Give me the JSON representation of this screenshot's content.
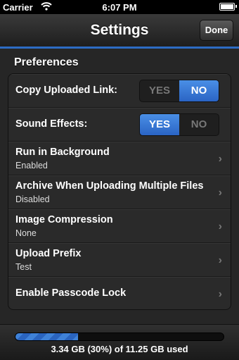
{
  "status_bar": {
    "carrier": "Carrier",
    "time": "6:07 PM"
  },
  "nav": {
    "title": "Settings",
    "done_label": "Done"
  },
  "preferences": {
    "header": "Preferences",
    "copy_link": {
      "label": "Copy Uploaded Link:",
      "yes": "YES",
      "no": "NO",
      "value": "NO"
    },
    "sound": {
      "label": "Sound Effects:",
      "yes": "YES",
      "no": "NO",
      "value": "YES"
    },
    "items": [
      {
        "label": "Run in Background",
        "value": "Enabled"
      },
      {
        "label": "Archive When Uploading Multiple Files",
        "value": "Disabled"
      },
      {
        "label": "Image Compression",
        "value": "None"
      },
      {
        "label": "Upload Prefix",
        "value": "Test"
      },
      {
        "label": "Enable Passcode Lock",
        "value": ""
      }
    ]
  },
  "storage": {
    "text": "3.34 GB (30%) of 11.25 GB used",
    "used_fraction": 0.3
  }
}
